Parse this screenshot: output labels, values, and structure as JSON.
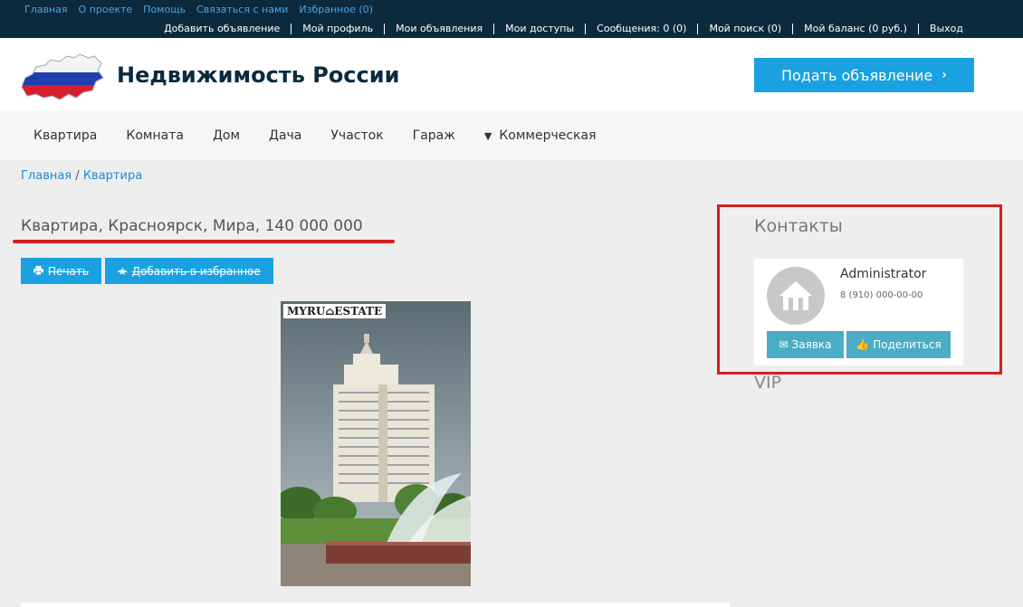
{
  "top_links": [
    "Главная",
    "О проекте",
    "Помощь",
    "Связаться с нами",
    "Избранное (0)"
  ],
  "user_menu": [
    "Добавить объявление",
    "Мой профиль",
    "Мои объявления",
    "Мои доступы",
    "Сообщения: 0 (0)",
    "Мой поиск (0)",
    "Мой баланс (0 руб.)",
    "Выход"
  ],
  "header": {
    "site_title": "Недвижимость России",
    "logo_icon": "russia-flag-map-icon",
    "submit_label": "Подать объявление",
    "submit_icon": "chevron-right-icon"
  },
  "nav": {
    "items": [
      "Квартира",
      "Комната",
      "Дом",
      "Дача",
      "Участок",
      "Гараж"
    ],
    "dropdown_label": "Коммерческая"
  },
  "breadcrumb": {
    "home": "Главная",
    "separator": " / ",
    "current": "Квартира"
  },
  "listing": {
    "title": "Квартира, Красноярск, Мира, 140 000 000",
    "print_label": "Печать",
    "print_icon": "printer-icon",
    "favorite_label": "Добавить в избранное",
    "favorite_icon": "star-icon",
    "watermark": "MYRU⌂ESTATE"
  },
  "contacts": {
    "title": "Контакты",
    "name": "Administrator",
    "phone": "8 (910) 000-00-00",
    "request_label": "Заявка",
    "request_icon": "envelope-icon",
    "share_label": "Поделиться",
    "share_icon": "thumbs-up-icon"
  },
  "vip_title": "VIP",
  "colors": {
    "topbar": "#0c2a3e",
    "accent": "#1aa1e1",
    "card_button": "#4bacc6",
    "annotation_red": "#d42020",
    "page_bg": "#eeeeee"
  }
}
